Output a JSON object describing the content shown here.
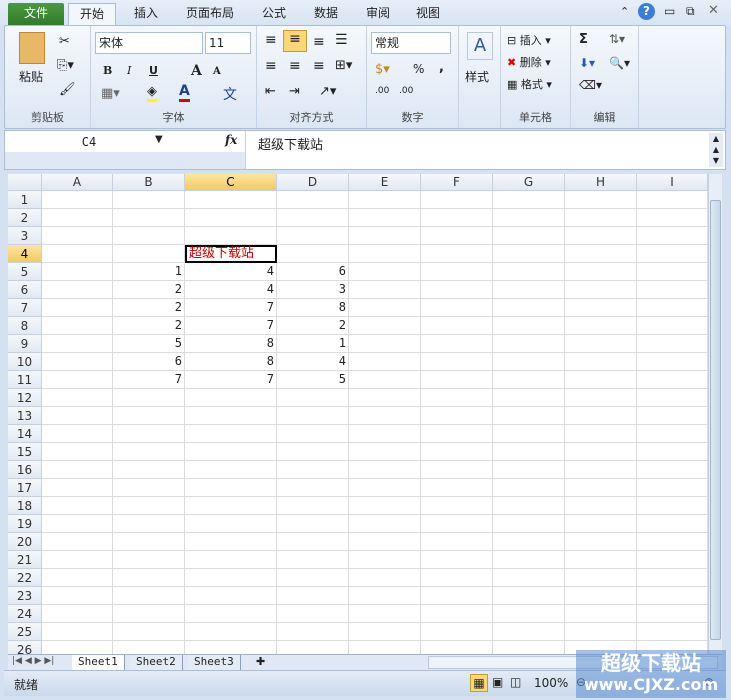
{
  "ribbon_tabs": [
    "文件",
    "开始",
    "插入",
    "页面布局",
    "公式",
    "数据",
    "审阅",
    "视图"
  ],
  "clipboard": {
    "paste": "粘贴",
    "label": "剪贴板"
  },
  "font": {
    "name": "宋体",
    "size": "11",
    "label": "字体",
    "bold": "B",
    "italic": "I",
    "underline": "U",
    "grow": "A",
    "shrink": "A",
    "font_color": "A",
    "phonetic": "文"
  },
  "alignment": {
    "label": "对齐方式"
  },
  "number": {
    "format": "常规",
    "percent": "%",
    "comma": ",",
    "inc": ".00",
    "label": "数字"
  },
  "styles": {
    "label": "样式"
  },
  "cells": {
    "insert": "插入",
    "delete": "删除",
    "format": "格式",
    "label": "单元格"
  },
  "editing": {
    "sum": "Σ",
    "label": "编辑"
  },
  "formula_bar": {
    "name_box": "C4",
    "fx": "fx",
    "content": "超级下载站"
  },
  "columns": [
    "A",
    "B",
    "C",
    "D",
    "E",
    "F",
    "G",
    "H",
    "I"
  ],
  "selected_column": "C",
  "selected_row": 4,
  "row_count": 26,
  "cell_data": {
    "C4": "超级下载站",
    "B5": "1",
    "C5": "4",
    "D5": "6",
    "B6": "2",
    "C6": "4",
    "D6": "3",
    "B7": "2",
    "C7": "7",
    "D7": "8",
    "B8": "2",
    "C8": "7",
    "D8": "2",
    "B9": "5",
    "C9": "8",
    "D9": "1",
    "B10": "6",
    "C10": "8",
    "D10": "4",
    "B11": "7",
    "C11": "7",
    "D11": "5"
  },
  "sheets": [
    "Sheet1",
    "Sheet2",
    "Sheet3"
  ],
  "active_sheet": "Sheet1",
  "status": {
    "ready": "就绪",
    "zoom": "100%"
  },
  "watermark": {
    "line1": "超级下载站",
    "line2": "www.CJXZ.com"
  },
  "colors": {
    "accent_text": "#c00000",
    "selection": "#f5c961"
  }
}
